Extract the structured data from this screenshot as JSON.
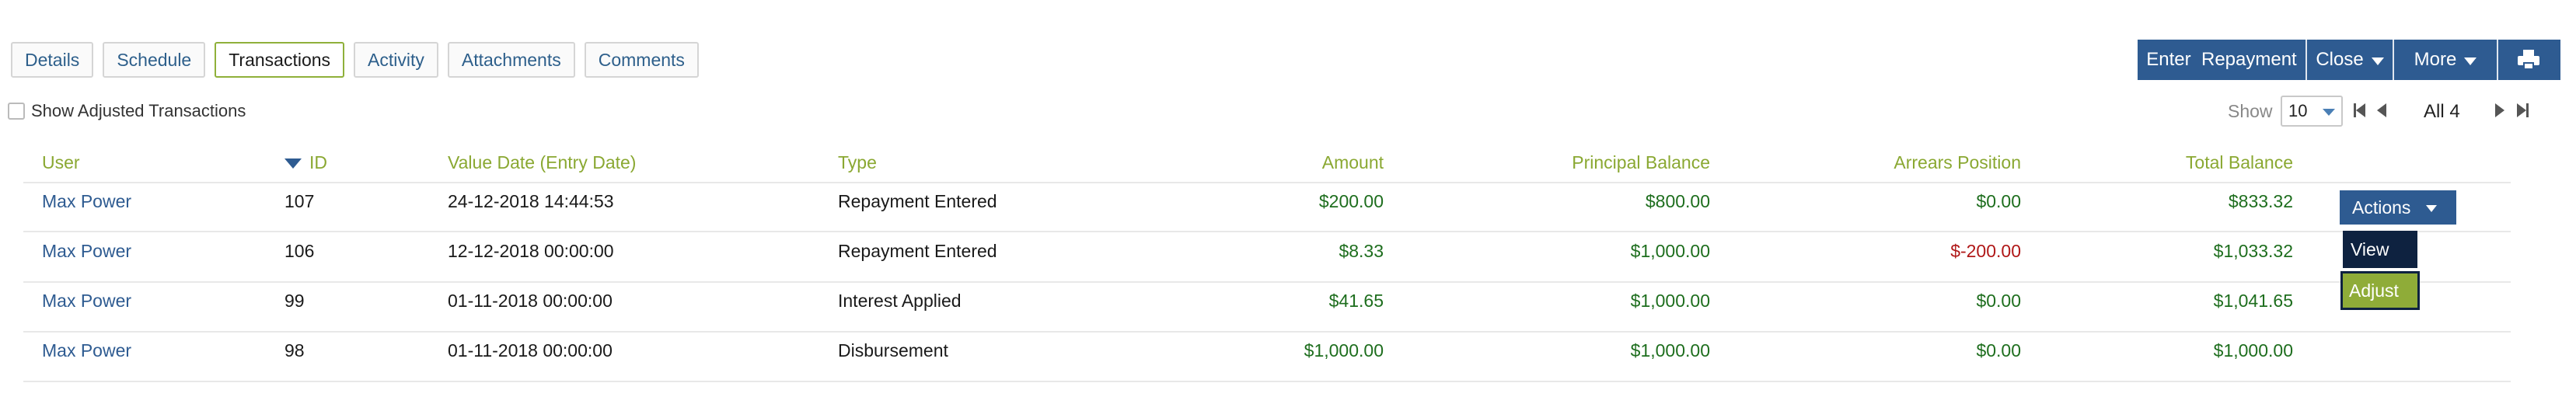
{
  "tabs": [
    {
      "label": "Details"
    },
    {
      "label": "Schedule"
    },
    {
      "label": "Transactions",
      "active": true
    },
    {
      "label": "Activity"
    },
    {
      "label": "Attachments"
    },
    {
      "label": "Comments"
    }
  ],
  "toolbar": {
    "enter_repayment": "Enter  Repayment",
    "close": "Close",
    "more": "More",
    "print_icon": "printer-icon"
  },
  "filters": {
    "show_adjusted_label": "Show Adjusted Transactions",
    "show_adjusted_checked": false
  },
  "pagination": {
    "show_label": "Show",
    "page_size": "10",
    "page_info": "All 4"
  },
  "table": {
    "headers": {
      "user": "User",
      "id": "ID",
      "value_date": "Value Date (Entry Date)",
      "type": "Type",
      "amount": "Amount",
      "principal_balance": "Principal Balance",
      "arrears_position": "Arrears Position",
      "total_balance": "Total Balance"
    },
    "sort": {
      "column": "id",
      "direction": "desc"
    },
    "rows": [
      {
        "user": "Max Power",
        "id": "107",
        "value_date": "24-12-2018 14:44:53",
        "type": "Repayment Entered",
        "amount": "$200.00",
        "principal_balance": "$800.00",
        "arrears_position": "$0.00",
        "total_balance": "$833.32"
      },
      {
        "user": "Max Power",
        "id": "106",
        "value_date": "12-12-2018 00:00:00",
        "type": "Repayment Entered",
        "amount": "$8.33",
        "principal_balance": "$1,000.00",
        "arrears_position": "$-200.00",
        "total_balance": "$1,033.32"
      },
      {
        "user": "Max Power",
        "id": "99",
        "value_date": "01-11-2018 00:00:00",
        "type": "Interest Applied",
        "amount": "$41.65",
        "principal_balance": "$1,000.00",
        "arrears_position": "$0.00",
        "total_balance": "$1,041.65"
      },
      {
        "user": "Max Power",
        "id": "98",
        "value_date": "01-11-2018 00:00:00",
        "type": "Disbursement",
        "amount": "$1,000.00",
        "principal_balance": "$1,000.00",
        "arrears_position": "$0.00",
        "total_balance": "$1,000.00"
      }
    ]
  },
  "actions_menu": {
    "button_label": "Actions",
    "items": [
      "View",
      "Adjust"
    ]
  },
  "colors": {
    "primary_blue": "#2e5b91",
    "header_green": "#8aa832",
    "positive_green": "#1e6e1e",
    "negative_red": "#b01818",
    "menu_dark": "#0e2240",
    "adjust_green": "#8fac38"
  }
}
